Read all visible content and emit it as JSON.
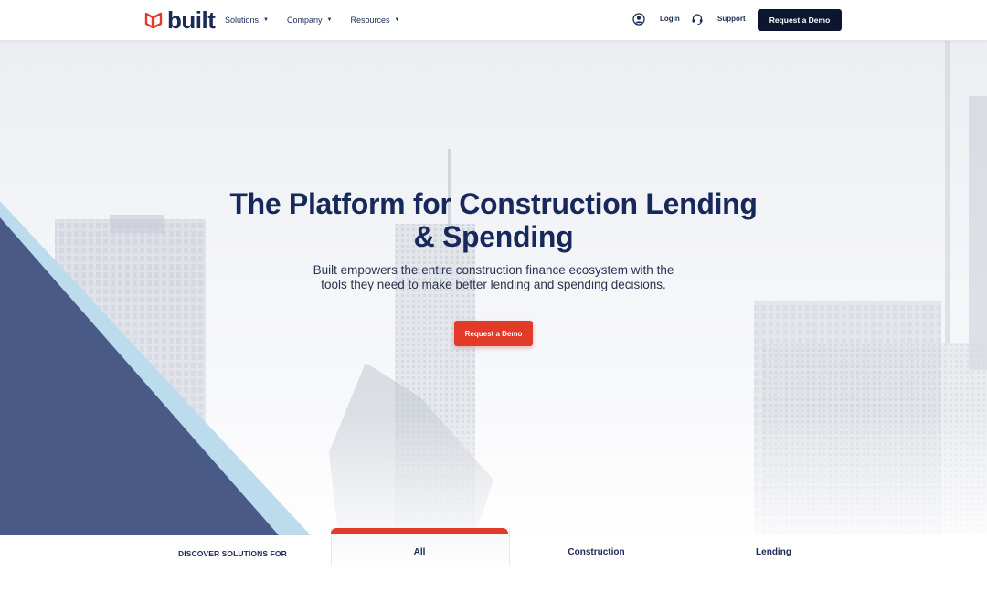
{
  "brand": {
    "name": "built",
    "mark_color": "#e23b2a"
  },
  "nav": {
    "items": [
      {
        "label": "Solutions"
      },
      {
        "label": "Company"
      },
      {
        "label": "Resources"
      }
    ],
    "login": "Login",
    "support": "Support",
    "cta": "Request a Demo"
  },
  "hero": {
    "title_line1": "The Platform for Construction Lending",
    "title_line2": "& Spending",
    "subtitle_line1": "Built empowers the entire construction finance ecosystem with the",
    "subtitle_line2": "tools they need to make better lending and spending decisions.",
    "cta": "Request a Demo"
  },
  "solutions": {
    "heading": "DISCOVER SOLUTIONS FOR",
    "tabs": [
      {
        "label": "All",
        "active": true
      },
      {
        "label": "Construction",
        "active": false
      },
      {
        "label": "Lending",
        "active": false
      }
    ]
  },
  "colors": {
    "navy": "#17295b",
    "accent_red": "#e23b2a",
    "dark_button": "#0d1631",
    "triangle": "#4a5a86",
    "triangle_edge": "#bcdcee"
  }
}
